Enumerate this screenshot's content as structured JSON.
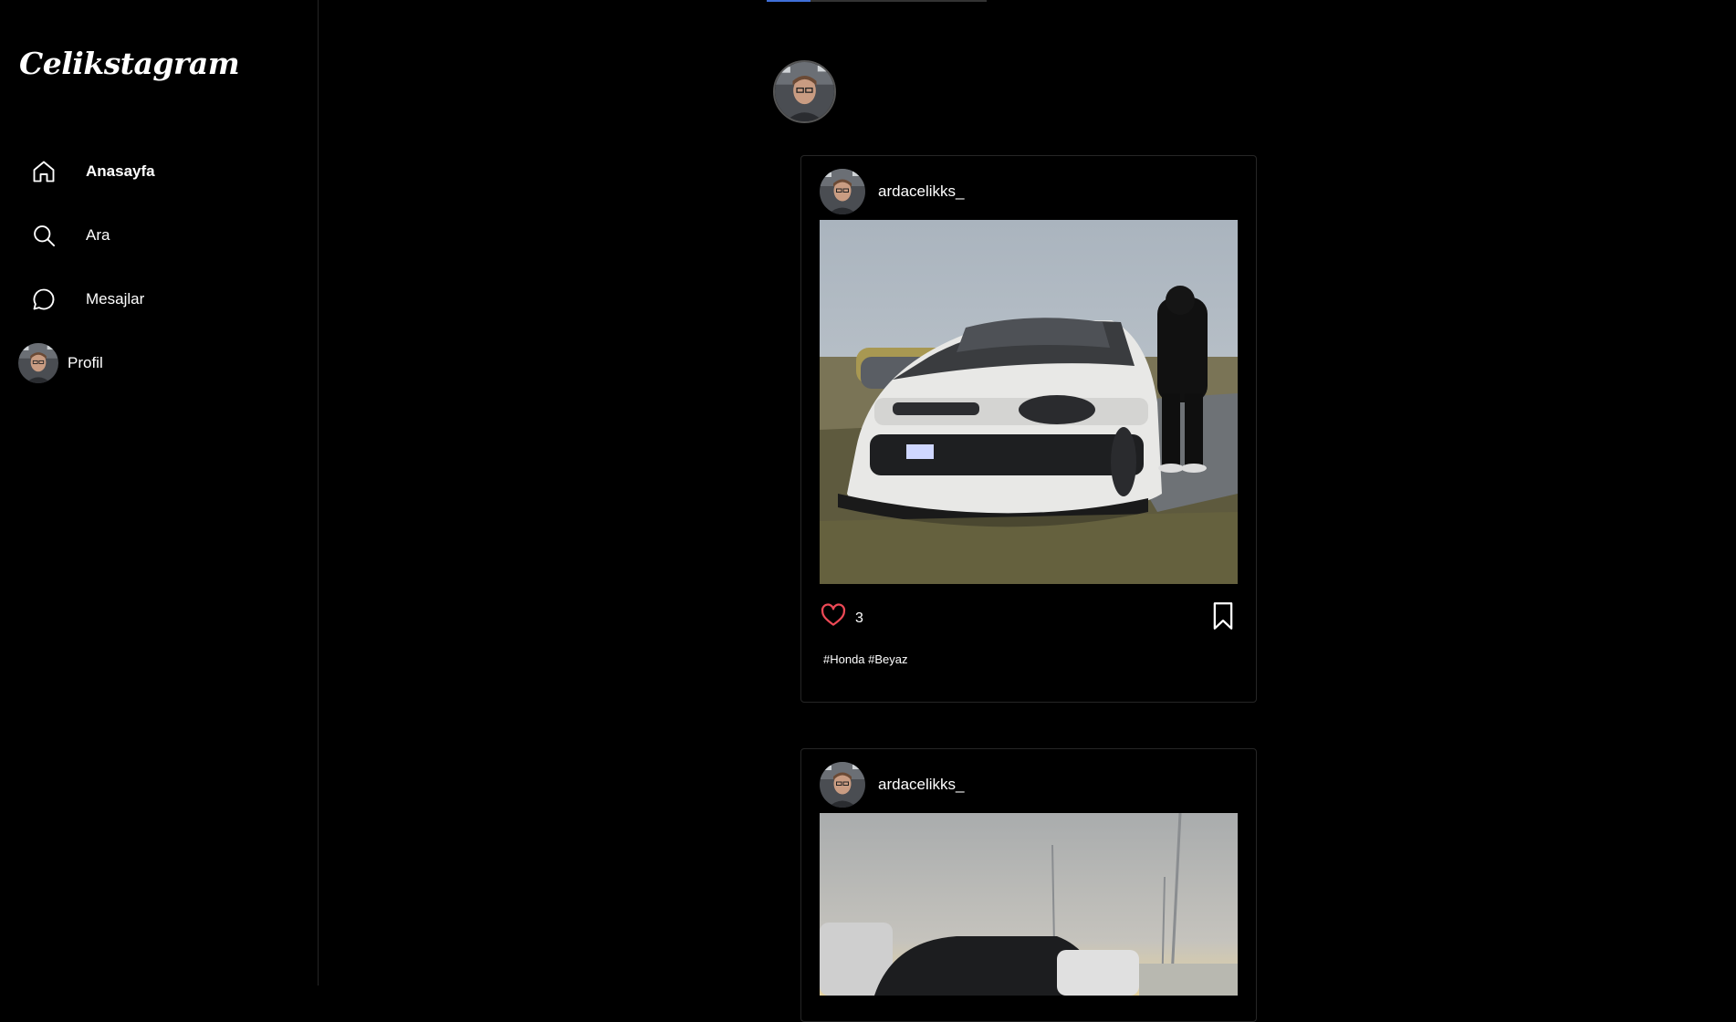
{
  "app": {
    "title": "Celikstagram"
  },
  "sidebar": {
    "items": [
      {
        "label": "Anasayfa",
        "icon": "home-icon",
        "active": true
      },
      {
        "label": "Ara",
        "icon": "search-icon"
      },
      {
        "label": "Mesajlar",
        "icon": "messages-icon"
      },
      {
        "label": "Profil",
        "icon": "avatar"
      }
    ]
  },
  "stories": {
    "progress": 0.2
  },
  "posts": [
    {
      "username": "ardacelikks_",
      "likes": "3",
      "caption": "#Honda #Beyaz"
    },
    {
      "username": "ardacelikks_"
    }
  ],
  "colors": {
    "background": "#000000",
    "like": "#ed4956",
    "progress": "#3f6fd8",
    "border": "#262626"
  }
}
